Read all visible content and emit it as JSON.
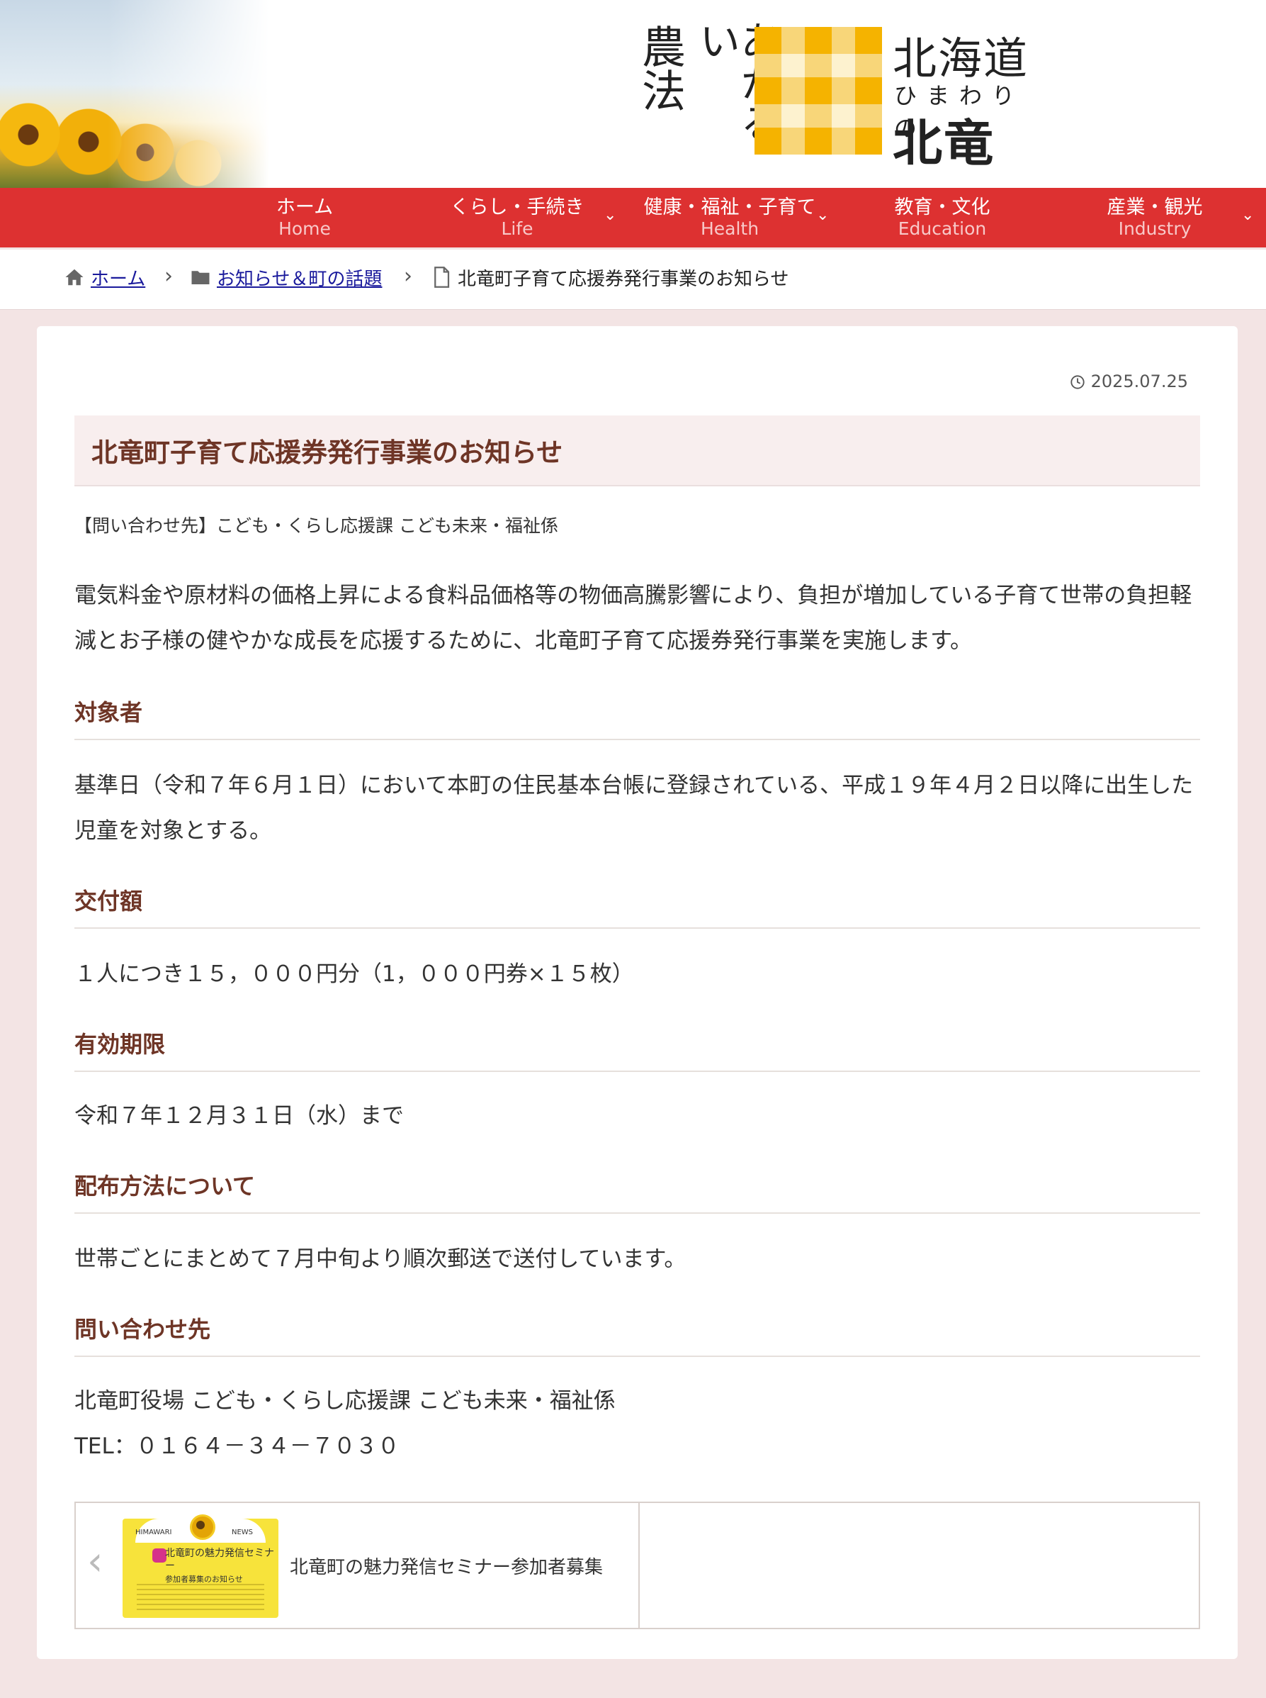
{
  "header": {
    "logo_vertical_left": "農法",
    "logo_vertical_right": "あかるい",
    "logo_prefecture": "北海道",
    "logo_subtitle": "ひまわりの",
    "logo_town": "北竜町",
    "logo_colors": {
      "dark": "#f5b300",
      "light": "#fbdf86"
    }
  },
  "nav": {
    "items": [
      {
        "ja": "ホーム",
        "en": "Home",
        "has_dropdown": false
      },
      {
        "ja": "くらし・手続き",
        "en": "Life",
        "has_dropdown": true
      },
      {
        "ja": "健康・福祉・子育て",
        "en": "Health",
        "has_dropdown": true
      },
      {
        "ja": "教育・文化",
        "en": "Education",
        "has_dropdown": false
      },
      {
        "ja": "産業・観光",
        "en": "Industry",
        "has_dropdown": true
      }
    ],
    "chevron": "⌄",
    "bg_color": "#dd3131"
  },
  "breadcrumb": {
    "home": "ホーム",
    "category": "お知らせ＆町の話題",
    "current": "北竜町子育て応援券発行事業のお知らせ",
    "separator": "›"
  },
  "article": {
    "date": "2025.07.25",
    "title": "北竜町子育て応援券発行事業のお知らせ",
    "contact_line": "【問い合わせ先】こども・くらし応援課 こども未来・福祉係",
    "intro": "電気料金や原材料の価格上昇による食料品価格等の物価高騰影響により、負担が増加している子育て世帯の負担軽減とお子様の健やかな成長を応援するために、北竜町子育て応援券発行事業を実施します。",
    "sections": [
      {
        "heading": "対象者",
        "body": "基準日（令和７年６月１日）において本町の住民基本台帳に登録されている、平成１９年４月２日以降に出生した児童を対象とする。"
      },
      {
        "heading": "交付額",
        "body": "１人につき１５，０００円分（1，０００円券×１５枚）"
      },
      {
        "heading": "有効期限",
        "body": "令和７年１２月３１日（水）まで"
      },
      {
        "heading": "配布方法について",
        "body": "世帯ごとにまとめて７月中旬より順次郵送で送付しています。"
      },
      {
        "heading": "問い合わせ先",
        "body": "北竜町役場 こども・くらし応援課 こども未来・福祉係",
        "body2": "TEL：０１６４－３４－７０３０"
      }
    ]
  },
  "pager": {
    "prev_arrow": "‹",
    "prev_title": "北竜町の魅力発信セミナー参加者募集",
    "thumb_label_left": "HIMAWARI",
    "thumb_label_right": "NEWS",
    "thumb_title": "北竜町の魅力発信セミナー",
    "thumb_subtitle": "参加者募集のお知らせ"
  }
}
